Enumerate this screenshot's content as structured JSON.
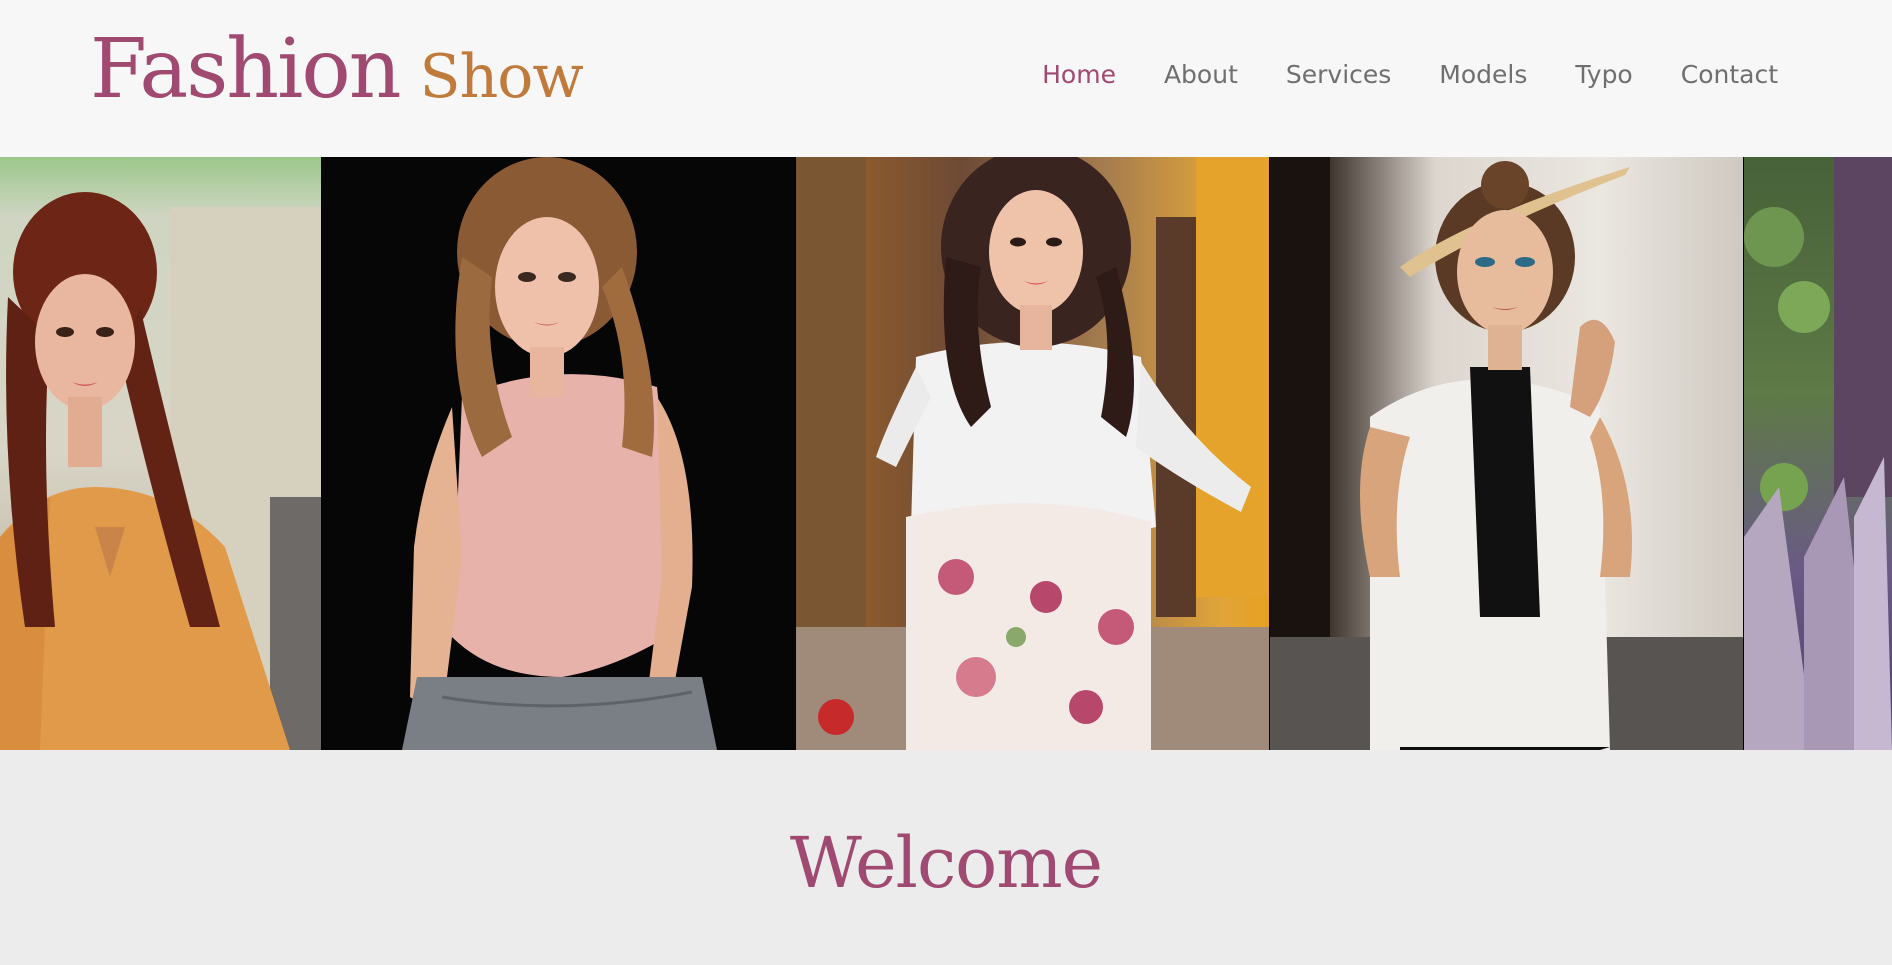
{
  "logo": {
    "part1": "Fashion",
    "part2": "Show"
  },
  "nav": {
    "items": [
      "Home",
      "About",
      "Services",
      "Models",
      "Typo",
      "Contact"
    ],
    "active": "Home"
  },
  "gallery": {
    "photos": [
      "woman-orange-sweater",
      "woman-pink-top-black-background",
      "woman-white-lace-floral-skirt",
      "woman-white-vest-black-shirt",
      "partial-photo-plants"
    ]
  },
  "welcome": {
    "title": "Welcome"
  },
  "colors": {
    "brand": "#a04a72",
    "accent": "#c07a3c",
    "nav_text": "#6f6f6f",
    "header_bg": "#f7f7f7",
    "page_bg": "#ececec"
  }
}
